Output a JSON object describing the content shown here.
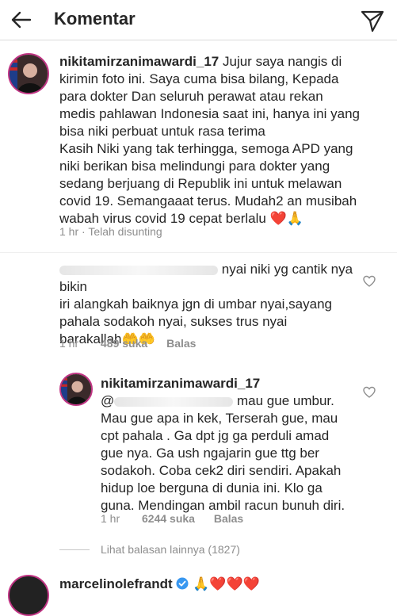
{
  "header": {
    "title": "Komentar"
  },
  "icons": {
    "back": "arrow-left-icon",
    "send": "paper-plane-icon",
    "like": "heart-outline-icon",
    "verified": "verified-badge-icon"
  },
  "main_comment": {
    "username": "nikitamirzanimawardi_17",
    "lines": [
      "Jujur saya nangis di",
      "kirimin foto ini. Saya cuma bisa bilang, Kepada",
      "para dokter Dan seluruh perawat atau rekan",
      "medis  pahlawan Indonesia saat ini, hanya ini yang",
      "bisa niki perbuat untuk rasa terima",
      "Kasih Niki yang tak terhingga, semoga APD yang",
      "niki berikan bisa melindungi para dokter yang",
      "sedang berjuang di Republik ini untuk melawan",
      "covid 19.  Semangaaat terus. Mudah2 an musibah",
      "wabah virus covid 19 cepat berlalu ❤️🙏"
    ],
    "meta": "1 hr · Telah disunting"
  },
  "comment2": {
    "lines": [
      "nyai niki yg cantik nya bikin",
      "iri alangkah baiknya jgn di umbar nyai,sayang",
      "pahala sodakoh nyai, sukses trus nyai",
      "barakallah🤲🤲"
    ],
    "time": "1 hr",
    "likes": "489 suka",
    "reply": "Balas"
  },
  "reply1": {
    "username": "nikitamirzanimawardi_17",
    "mention_prefix": "@",
    "lines": [
      "mau gue umbur.",
      "Mau gue apa in kek, Terserah gue, mau",
      "cpt pahala . Ga dpt jg ga perduli amad",
      "gue nya. Ga ush ngajarin gue ttg ber",
      "sodakoh. Coba cek2 diri sendiri. Apakah",
      "hidup loe berguna di dunia ini. Klo ga",
      "guna. Mendingan ambil racun bunuh diri."
    ],
    "time": "1 hr",
    "likes": "6244 suka",
    "reply": "Balas"
  },
  "view_replies": "Lihat balasan lainnya (1827)",
  "comment3": {
    "username": "marcelinolefrandt",
    "text": "🙏❤️❤️❤️"
  }
}
